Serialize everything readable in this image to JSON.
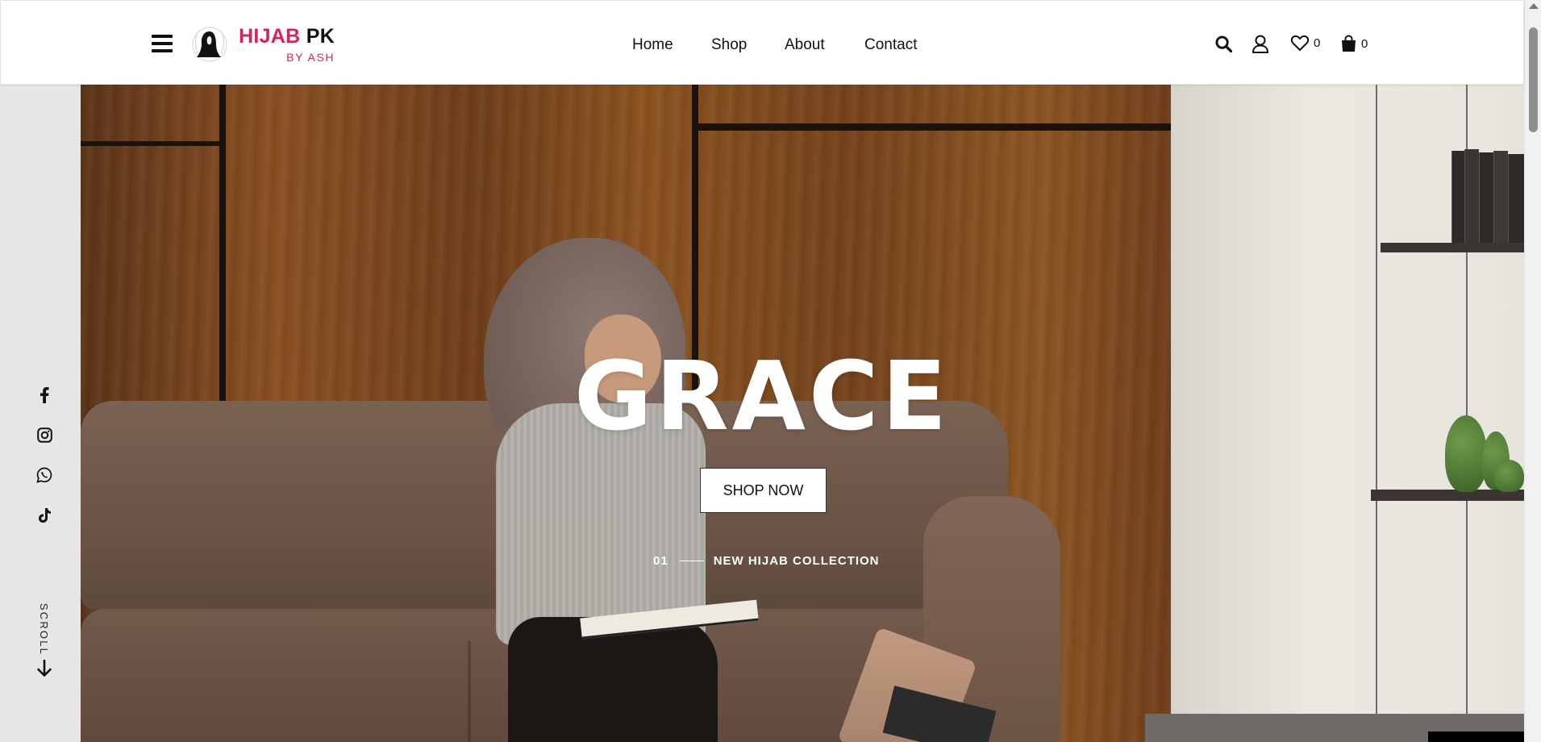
{
  "brand": {
    "name_accent": "HIJAB",
    "name_dark": "PK",
    "tagline": "BY ASH",
    "accent_color": "#d6245a"
  },
  "header": {
    "menu_icon": "hamburger-menu-icon",
    "nav": {
      "home": "Home",
      "shop": "Shop",
      "about": "About",
      "contact": "Contact"
    },
    "icons": {
      "search": "search-icon",
      "account": "user-icon",
      "wishlist": "heart-icon",
      "cart": "shopping-bag-icon"
    },
    "wishlist_count": "0",
    "cart_count": "0"
  },
  "sidebar": {
    "social": [
      "facebook-icon",
      "instagram-icon",
      "whatsapp-icon",
      "tiktok-icon"
    ],
    "scroll_label": "SCROLL",
    "scroll_icon": "arrow-down-icon"
  },
  "hero": {
    "title": "GRACE",
    "button_label": "SHOP NOW",
    "slide_number": "01",
    "slide_caption": "NEW HIJAB COLLECTION",
    "text_color": "#ffffff"
  }
}
